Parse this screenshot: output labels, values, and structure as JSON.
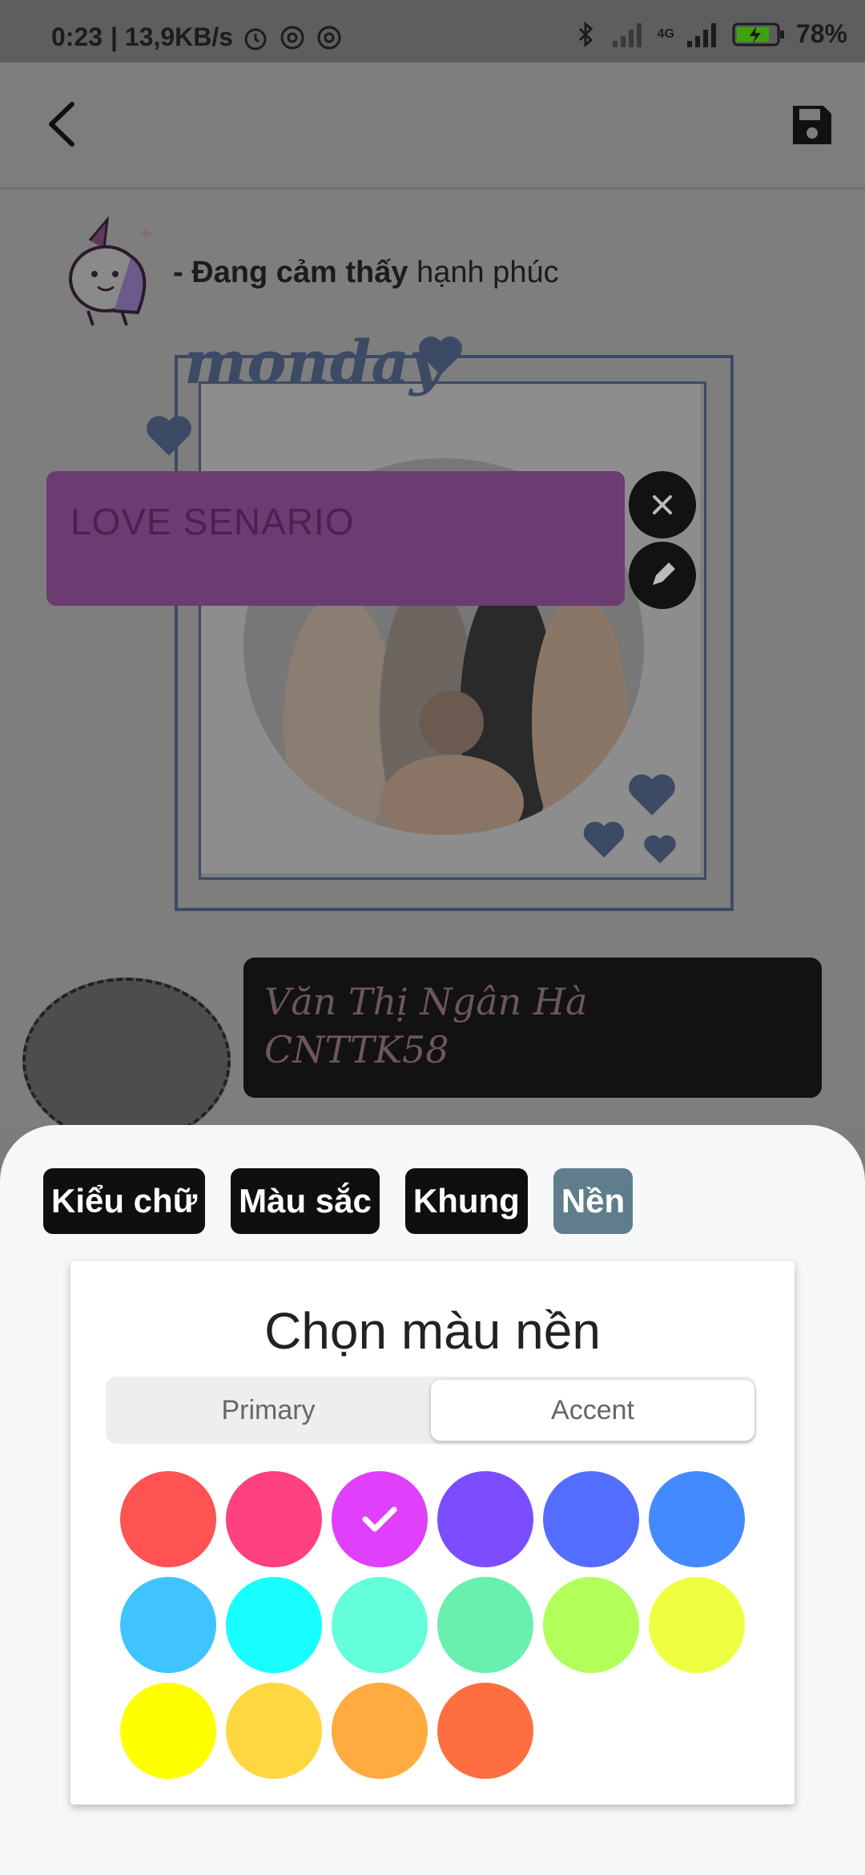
{
  "status_bar": {
    "time": "0:23",
    "speed": "| 13,9KB/s",
    "network_label": "4G",
    "battery": "78%"
  },
  "app_bar": {
    "back_icon": "chevron-left-icon",
    "save_icon": "floppy-disk-icon"
  },
  "post": {
    "mood_prefix": "- Đang cảm thấy",
    "mood_value": "hạnh phúc",
    "sticker_text": "monday",
    "text_box": "LOVE SENARIO",
    "author_line1": "Văn Thị Ngân Hà",
    "author_line2": "CNTTK58"
  },
  "colors": {
    "text_box_bg": "#6c3b71",
    "active_tab": "#607d8b"
  },
  "sheet": {
    "tabs": [
      {
        "label": "Kiểu chữ",
        "active": false
      },
      {
        "label": "Màu sắc",
        "active": false
      },
      {
        "label": "Khung",
        "active": false
      },
      {
        "label": "Nền",
        "active": true
      }
    ],
    "title": "Chọn màu nền",
    "segments": [
      {
        "label": "Primary",
        "selected": false
      },
      {
        "label": "Accent",
        "selected": true
      }
    ],
    "swatches": [
      "#ff5252",
      "#ff4081",
      "#e040fb",
      "#7c4dff",
      "#536dfe",
      "#448aff",
      "#40c4ff",
      "#18ffff",
      "#64ffda",
      "#69f0ae",
      "#b2ff59",
      "#eeff41",
      "#ffff00",
      "#ffd740",
      "#ffab40",
      "#ff6e40"
    ],
    "selected_swatch": 2
  }
}
